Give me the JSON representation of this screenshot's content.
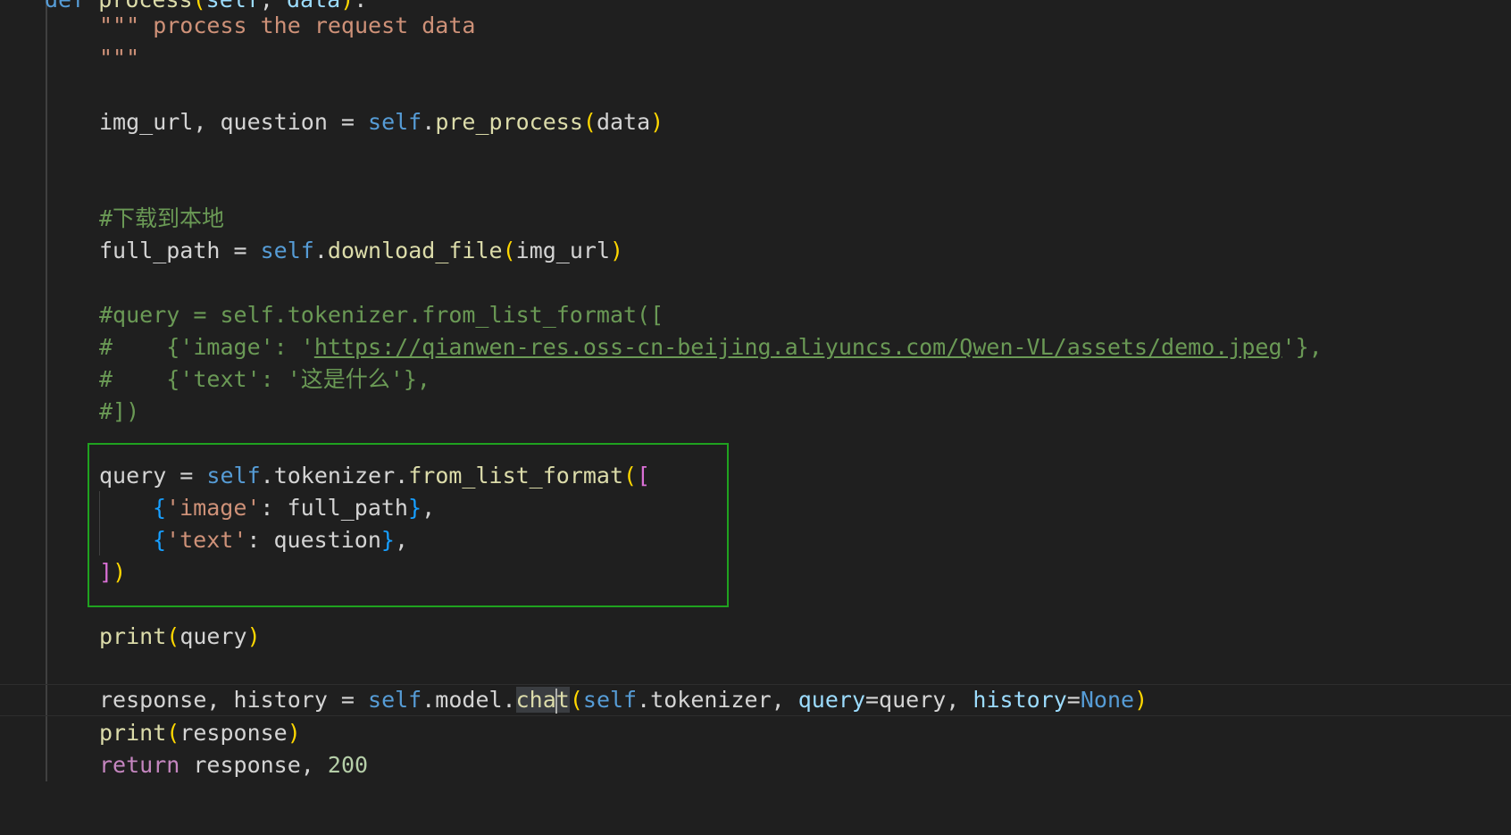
{
  "editor": {
    "line0": {
      "kw": "def",
      "fn": "process",
      "open": "(",
      "self": "self",
      "sep": ", ",
      "arg": "data",
      "close": ")",
      "colon": ":"
    },
    "docstring": {
      "line1": "\"\"\" process the request data",
      "line2": "\"\"\""
    },
    "line_pre_process": {
      "lhs": "img_url, question = ",
      "self": "self",
      "dot": ".",
      "fn": "pre_process",
      "open": "(",
      "arg": "data",
      "close": ")"
    },
    "comment_download": "#下载到本地",
    "line_download": {
      "lhs": "full_path = ",
      "self": "self",
      "dot": ".",
      "fn": "download_file",
      "open": "(",
      "arg": "img_url",
      "close": ")"
    },
    "comment_block": {
      "c1": "#query = self.tokenizer.from_list_format([",
      "c2_prefix": "#    {'image': '",
      "c2_url": "https://qianwen-res.oss-cn-beijing.aliyuncs.com/Qwen-VL/assets/demo.jpeg",
      "c2_suffix": "'},",
      "c3": "#    {'text': '这是什么'},",
      "c4": "#])"
    },
    "query_block": {
      "lhs": "query = ",
      "self": "self",
      "mid": ".tokenizer.",
      "fn": "from_list_format",
      "open_paren": "(",
      "open_bracket": "[",
      "image_open": "{",
      "image_key": "'image'",
      "image_colon": ": full_path",
      "image_close": "}",
      "image_comma": ",",
      "text_open": "{",
      "text_key": "'text'",
      "text_colon": ": question",
      "text_close": "}",
      "text_comma": ",",
      "close_bracket": "]",
      "close_paren": ")"
    },
    "print_query": {
      "fn": "print",
      "open": "(",
      "arg": "query",
      "close": ")"
    },
    "response_line": {
      "lhs": "response, history = ",
      "self1": "self",
      "mid1": ".model.",
      "fn_a": "cha",
      "fn_b": "t",
      "open": "(",
      "self2": "self",
      "mid2": ".tokenizer, ",
      "kw1": "query",
      "eq1": "=query, ",
      "kw2": "history",
      "eq2": "=",
      "none": "None",
      "close": ")"
    },
    "print_response": {
      "fn": "print",
      "open": "(",
      "arg": "response",
      "close": ")"
    },
    "return_line": {
      "kw": "return",
      "mid": " response, ",
      "num": "200"
    }
  }
}
